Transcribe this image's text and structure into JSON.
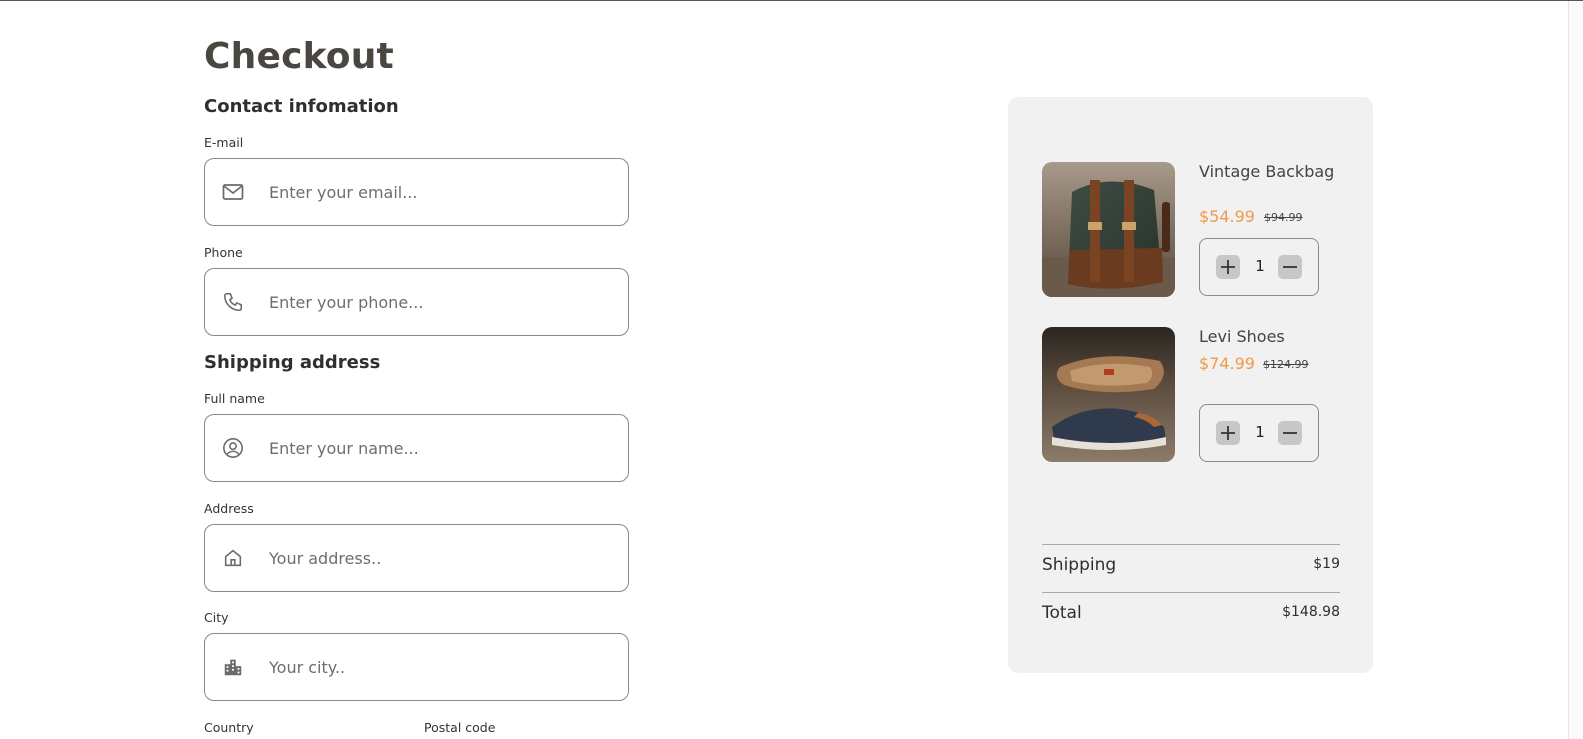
{
  "page": {
    "title": "Checkout"
  },
  "contact": {
    "heading": "Contact infomation",
    "email": {
      "label": "E-mail",
      "placeholder": "Enter your email...",
      "value": "",
      "icon": "mail-icon"
    },
    "phone": {
      "label": "Phone",
      "placeholder": "Enter your phone...",
      "value": "",
      "icon": "phone-icon"
    }
  },
  "shipping": {
    "heading": "Shipping address",
    "full_name": {
      "label": "Full name",
      "placeholder": "Enter your name...",
      "value": "",
      "icon": "user-circle-icon"
    },
    "address": {
      "label": "Address",
      "placeholder": "Your address..",
      "value": "",
      "icon": "home-icon"
    },
    "city": {
      "label": "City",
      "placeholder": "Your city..",
      "value": "",
      "icon": "building-icon"
    },
    "country": {
      "label": "Country"
    },
    "postal_code": {
      "label": "Postal code"
    }
  },
  "cart": {
    "items": [
      {
        "name": "Vintage Backbag",
        "price": "$54.99",
        "old_price": "$94.99",
        "quantity": "1",
        "image": "green leather backpack"
      },
      {
        "name": "Levi Shoes",
        "price": "$74.99",
        "old_price": "$124.99",
        "quantity": "1",
        "image": "navy canvas sneakers"
      }
    ],
    "shipping_label": "Shipping",
    "shipping_value": "$19",
    "total_label": "Total",
    "total_value": "$148.98"
  },
  "colors": {
    "accent_price": "#f2994a",
    "summary_bg": "#f1f1f1",
    "title_text": "#4a4640"
  }
}
